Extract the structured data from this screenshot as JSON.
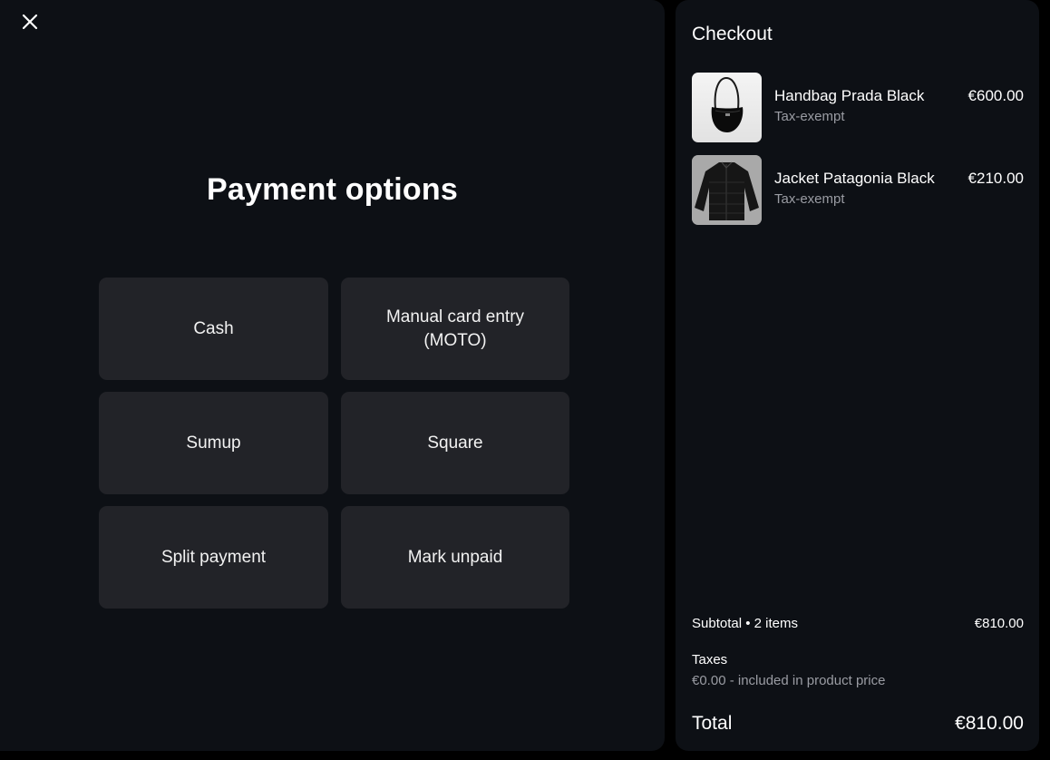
{
  "payment": {
    "title": "Payment options",
    "options": [
      {
        "label": "Cash"
      },
      {
        "label": "Manual card entry\n(MOTO)"
      },
      {
        "label": "Sumup"
      },
      {
        "label": "Square"
      },
      {
        "label": "Split payment"
      },
      {
        "label": "Mark unpaid"
      }
    ]
  },
  "checkout": {
    "title": "Checkout",
    "items": [
      {
        "name": "Handbag Prada Black",
        "note": "Tax-exempt",
        "price": "€600.00",
        "icon": "handbag-thumbnail"
      },
      {
        "name": "Jacket Patagonia Black",
        "note": "Tax-exempt",
        "price": "€210.00",
        "icon": "jacket-thumbnail"
      }
    ],
    "subtotal_label": "Subtotal • 2 items",
    "subtotal_value": "€810.00",
    "taxes_label": "Taxes",
    "taxes_note": "€0.00 - included in product price",
    "total_label": "Total",
    "total_value": "€810.00"
  },
  "colors": {
    "panel": "#0d1015",
    "button": "#222328",
    "muted_text": "#9a9ca3"
  }
}
